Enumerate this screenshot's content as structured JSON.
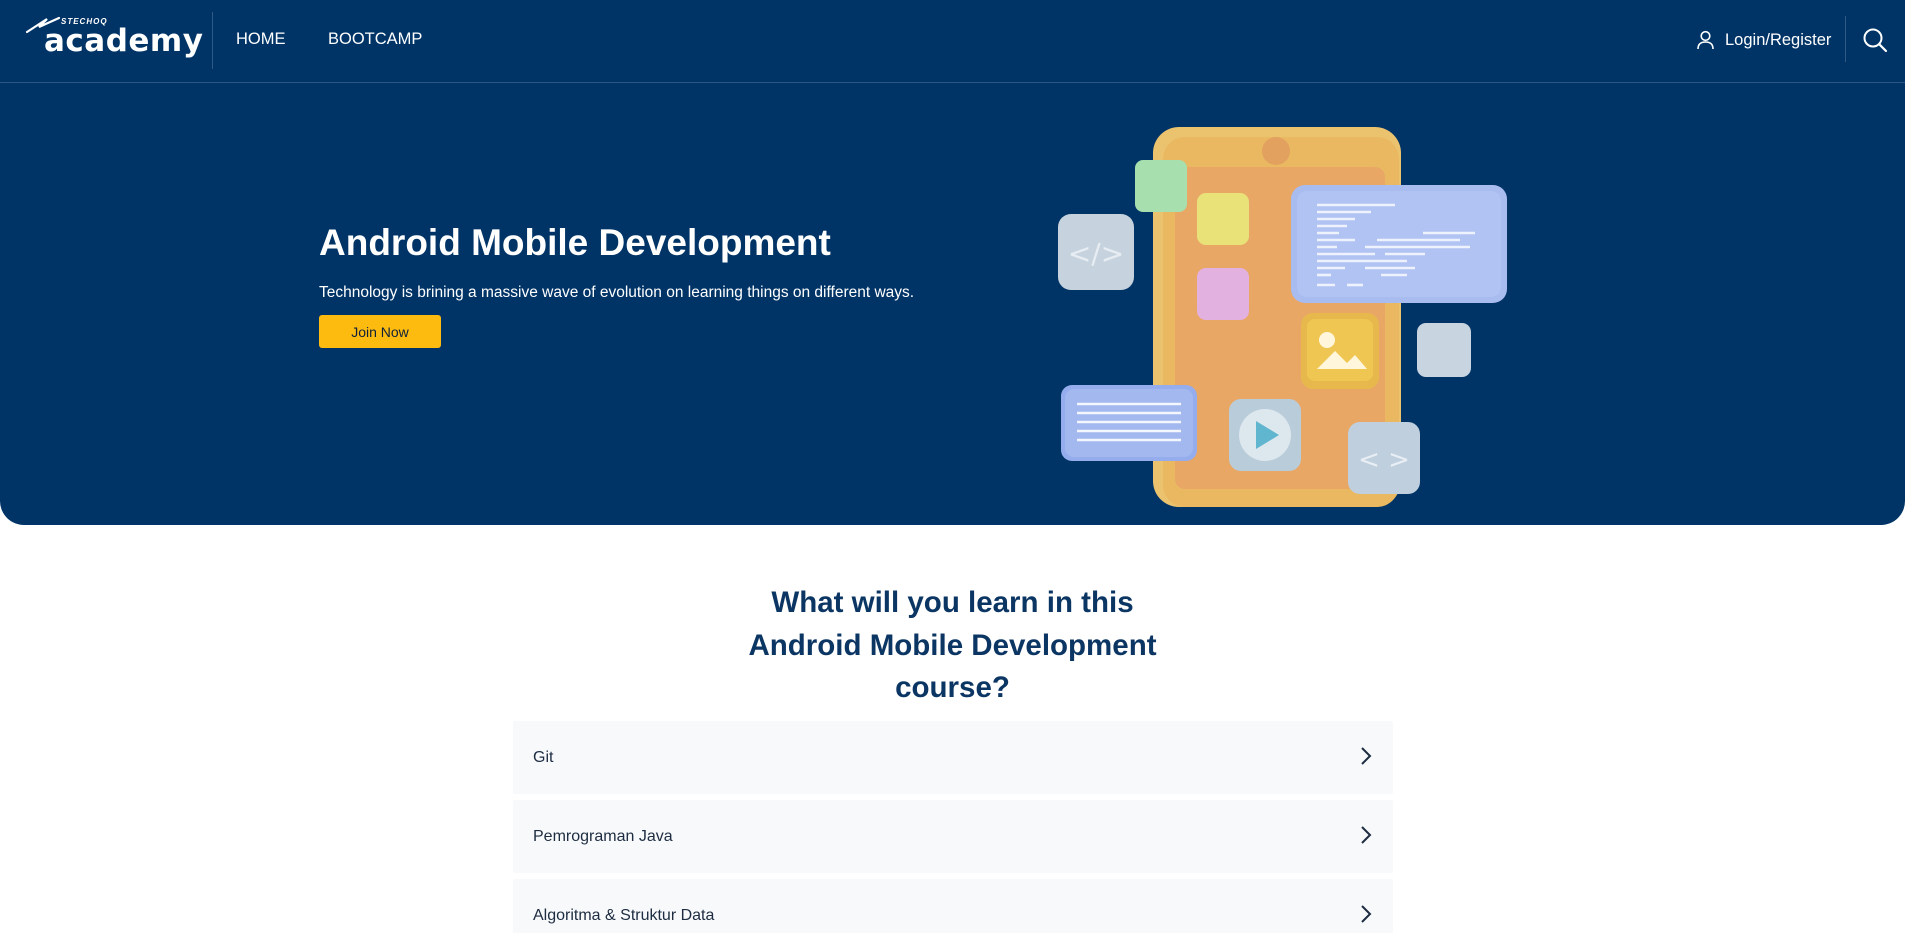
{
  "brand": {
    "small": "STECHOQ",
    "name": "academy"
  },
  "nav": {
    "links": [
      "HOME",
      "BOOTCAMP"
    ],
    "login_label": "Login/Register",
    "icons": {
      "user": "user-icon",
      "search": "search-icon"
    }
  },
  "hero": {
    "title": "Android Mobile Development",
    "subtitle": "Technology is brining a massive wave of evolution on learning things on different ways.",
    "cta_label": "Join Now",
    "illustration": "phone-apps-illustration",
    "illustration_code_labels": [
      "</>",
      "< >"
    ]
  },
  "learn": {
    "title_lines": [
      "What will you learn in this",
      "Android Mobile Development",
      "course?"
    ],
    "items": [
      "Git",
      "Pemrograman Java",
      "Algoritma & Struktur Data"
    ],
    "item_icon": "chevron-right-icon"
  },
  "colors": {
    "primary": "#003466",
    "accent": "#fdbb10",
    "heading": "#0b3563",
    "list_bg": "#f7f9fb"
  }
}
